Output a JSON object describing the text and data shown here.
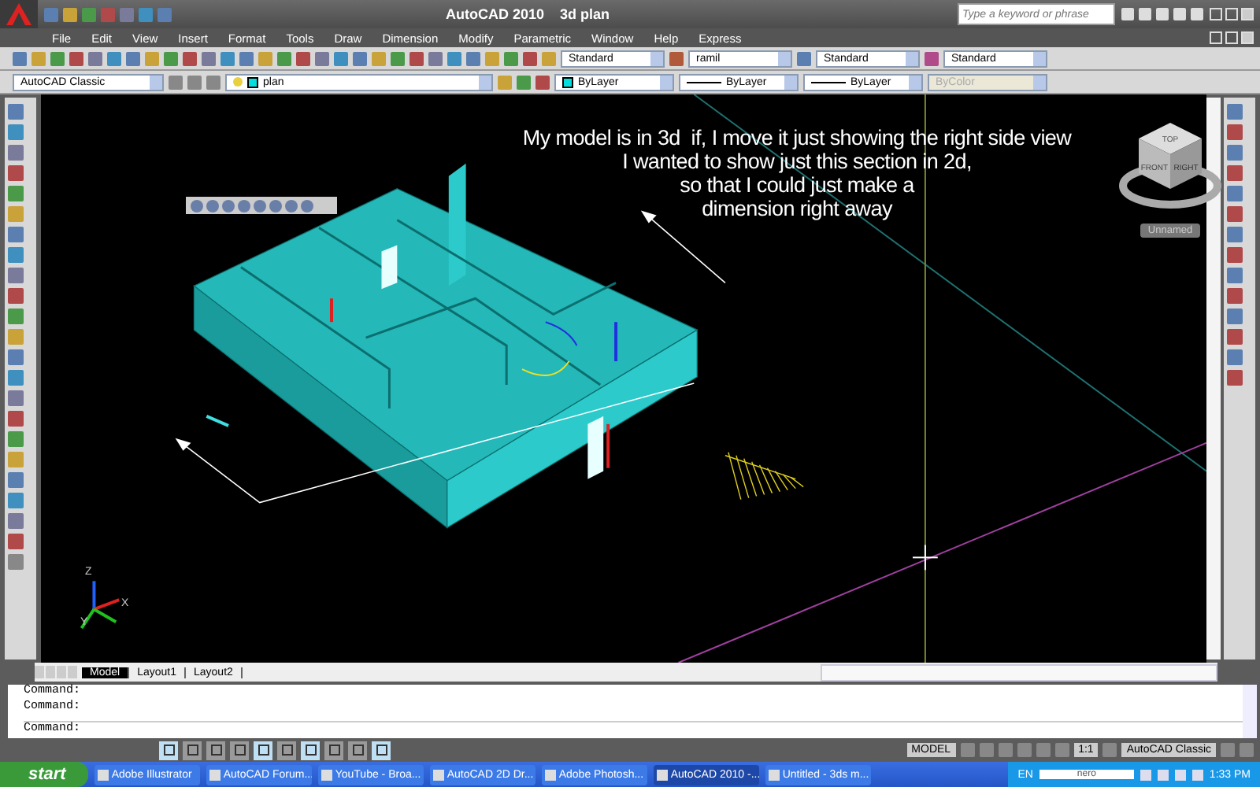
{
  "window": {
    "title": "AutoCAD 2010",
    "document": "3d plan"
  },
  "search": {
    "placeholder": "Type a keyword or phrase"
  },
  "menus": [
    "File",
    "Edit",
    "View",
    "Insert",
    "Format",
    "Tools",
    "Draw",
    "Dimension",
    "Modify",
    "Parametric",
    "Window",
    "Help",
    "Express"
  ],
  "styles_toolbar": [
    {
      "kind": "text",
      "value": "Standard"
    },
    {
      "kind": "dimension",
      "value": "ramil"
    },
    {
      "kind": "table",
      "value": "Standard"
    },
    {
      "kind": "multileader",
      "value": "Standard"
    }
  ],
  "workspace": "AutoCAD Classic",
  "layer": "plan",
  "properties": [
    {
      "kind": "color",
      "value": "ByLayer",
      "disabled": false
    },
    {
      "kind": "linetype",
      "value": "ByLayer",
      "disabled": false
    },
    {
      "kind": "lineweight",
      "value": "ByLayer",
      "disabled": false
    },
    {
      "kind": "plotstyle",
      "value": "ByColor",
      "disabled": true
    }
  ],
  "annotation": {
    "lines": [
      "My model is in 3d  if, I move it just showing the right side view",
      "I wanted to show just this section in 2d,",
      "so that I could just make a",
      "dimension right away"
    ]
  },
  "view_cube": {
    "faces": [
      "TOP",
      "FRONT",
      "RIGHT"
    ],
    "view_name": "Unnamed"
  },
  "ucs": {
    "axes": [
      "X",
      "Y",
      "Z"
    ]
  },
  "layout_tabs": [
    {
      "label": "Model",
      "selected": true
    },
    {
      "label": "Layout1",
      "selected": false
    },
    {
      "label": "Layout2",
      "selected": false
    }
  ],
  "command_lines": [
    "Command:",
    "Command:",
    "Command:"
  ],
  "status_bar": {
    "toggles": [
      {
        "on": true
      },
      {
        "on": false
      },
      {
        "on": false
      },
      {
        "on": false
      },
      {
        "on": true
      },
      {
        "on": false
      },
      {
        "on": true
      },
      {
        "on": false
      },
      {
        "on": false
      },
      {
        "on": true
      }
    ],
    "space": "MODEL",
    "annotation_scale": "1:1",
    "workspace": "AutoCAD Classic"
  },
  "taskbar": {
    "start": "start",
    "tasks": [
      {
        "label": "Adobe Illustrator",
        "selected": false
      },
      {
        "label": "AutoCAD Forum...",
        "selected": false
      },
      {
        "label": "YouTube - Broa...",
        "selected": false
      },
      {
        "label": "AutoCAD 2D Dr...",
        "selected": false
      },
      {
        "label": "Adobe Photosh...",
        "selected": false
      },
      {
        "label": "AutoCAD 2010 -...",
        "selected": true
      },
      {
        "label": "Untitled - 3ds m...",
        "selected": false
      }
    ],
    "language": "EN",
    "search_logo": "nero",
    "clock": "1:33 PM"
  }
}
